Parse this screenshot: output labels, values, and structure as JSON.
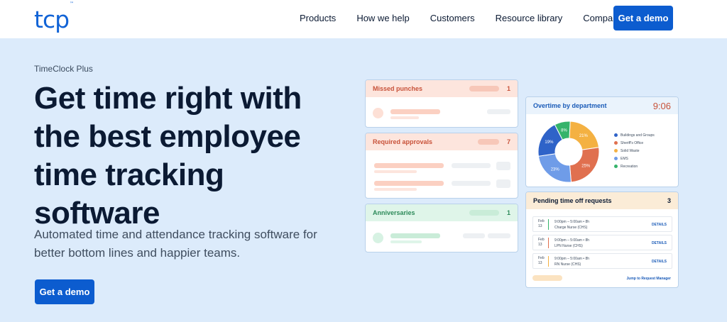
{
  "nav": {
    "logo": "tcp",
    "logo_tm": "™",
    "links": [
      "Products",
      "How we help",
      "Customers",
      "Resource library",
      "Company"
    ],
    "cta": "Get a demo"
  },
  "hero": {
    "eyebrow": "TimeClock Plus",
    "headline": "Get time right with the best employee time tracking software",
    "subhead": "Automated time and attendance tracking software for better bottom lines and happier teams.",
    "cta": "Get a demo"
  },
  "cards": {
    "missed": {
      "title": "Missed punches",
      "count": "1"
    },
    "required": {
      "title": "Required approvals",
      "count": "7"
    },
    "anniversaries": {
      "title": "Anniversaries",
      "count": "1"
    },
    "overtime": {
      "title": "Overtime by department",
      "time": "9:06",
      "slices": [
        {
          "label": "21%",
          "value": 21,
          "color": "#f4b142"
        },
        {
          "label": "25%",
          "value": 25,
          "color": "#e0704f"
        },
        {
          "label": "23%",
          "value": 23,
          "color": "#6f9ce8"
        },
        {
          "label": "19%",
          "value": 19,
          "color": "#2f63c8"
        },
        {
          "label": "8%",
          "value": 8,
          "color": "#35b36b"
        }
      ],
      "legend": [
        {
          "label": "Buildings and Groups",
          "color": "#2f63c8"
        },
        {
          "label": "Sheriff's Office",
          "color": "#e0704f"
        },
        {
          "label": "Solid Waste",
          "color": "#f4b142"
        },
        {
          "label": "EMS",
          "color": "#6f9ce8"
        },
        {
          "label": "Recreation",
          "color": "#35b36b"
        }
      ]
    },
    "pto": {
      "title": "Pending time off requests",
      "count": "3",
      "rows": [
        {
          "month": "Feb",
          "day": "13",
          "time": "9:00pm – 5:00am • 8h",
          "role": "Charge Nurse (CHS)",
          "action": "DETAILS",
          "color": "#35b36b"
        },
        {
          "month": "Feb",
          "day": "13",
          "time": "9:00pm – 5:00am • 8h",
          "role": "LPN Nurse (CHS)",
          "action": "DETAILS",
          "color": "#e0704f"
        },
        {
          "month": "Feb",
          "day": "13",
          "time": "9:00pm – 5:00am • 8h",
          "role": "RN Nurse (CHS)",
          "action": "DETAILS",
          "color": "#f4b142"
        }
      ],
      "jump": "Jump to Request Manager"
    }
  }
}
